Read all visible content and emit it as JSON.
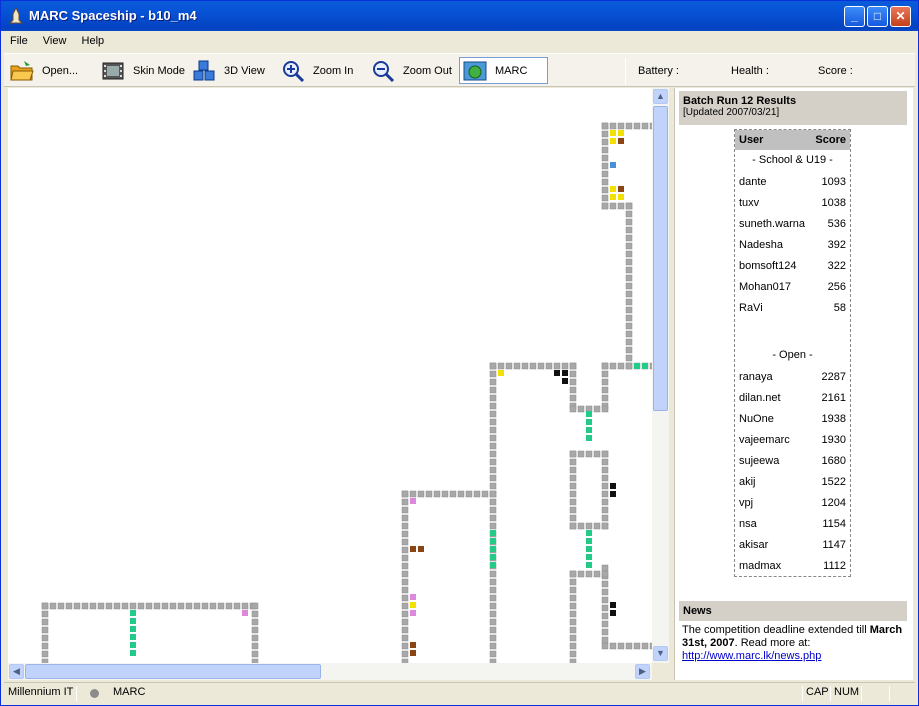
{
  "window": {
    "title": "MARC Spaceship - b10_m4"
  },
  "menu": {
    "file": "File",
    "view": "View",
    "help": "Help"
  },
  "toolbar": {
    "open": "Open...",
    "skin": "Skin Mode",
    "view3d": "3D View",
    "zoom_in": "Zoom In",
    "zoom_out": "Zoom Out",
    "marc": "MARC",
    "battery": "Battery :",
    "health": "Health :",
    "score": "Score :"
  },
  "results": {
    "title": "Batch Run 12 Results",
    "updated": "[Updated 2007/03/21]",
    "col_user": "User",
    "col_score": "Score",
    "group1": "- School & U19 -",
    "group1_rows": [
      {
        "user": "dante",
        "score": "1093"
      },
      {
        "user": "tuxv",
        "score": "1038"
      },
      {
        "user": "suneth.warna",
        "score": "536"
      },
      {
        "user": "Nadesha",
        "score": "392"
      },
      {
        "user": "bomsoft124",
        "score": "322"
      },
      {
        "user": "Mohan017",
        "score": "256"
      },
      {
        "user": "RaVi",
        "score": "58"
      }
    ],
    "group2": "- Open -",
    "group2_rows": [
      {
        "user": "ranaya",
        "score": "2287"
      },
      {
        "user": "dilan.net",
        "score": "2161"
      },
      {
        "user": "NuOne",
        "score": "1938"
      },
      {
        "user": "vajeemarc",
        "score": "1930"
      },
      {
        "user": "sujeewa",
        "score": "1680"
      },
      {
        "user": "akij",
        "score": "1522"
      },
      {
        "user": "vpj",
        "score": "1204"
      },
      {
        "user": "nsa",
        "score": "1154"
      },
      {
        "user": "akisar",
        "score": "1147"
      },
      {
        "user": "madmax",
        "score": "1112"
      }
    ]
  },
  "news": {
    "title": "News",
    "text": "The competition deadline extended till ",
    "bold": "March 31st, 2007",
    "after": ". Read more at:",
    "link": "http://www.marc.lk/news.php"
  },
  "status": {
    "company": "Millennium IT",
    "mode": "MARC",
    "cap": "CAP",
    "num": "NUM"
  },
  "colors": {
    "wall": "#a8a8a8",
    "yellow": "#f2e000",
    "brown": "#8b4513",
    "blue": "#4a90d9",
    "green": "#22cc88",
    "black": "#111111",
    "pink": "#dd88dd"
  }
}
